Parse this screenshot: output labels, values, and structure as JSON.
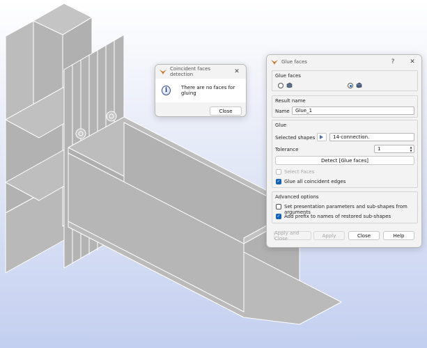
{
  "info_dialog": {
    "title": "Coincident faces detection",
    "message": "There are no faces for gluing",
    "close_label": "Close",
    "close_glyph": "✕"
  },
  "glue_dialog": {
    "title": "Glue faces",
    "help_glyph": "?",
    "close_glyph": "✕",
    "type_group": {
      "title": "Glue faces",
      "selected_option": 2
    },
    "result_group": {
      "title": "Result name",
      "name_label": "Name",
      "name_value": "Glue_1"
    },
    "glue_group": {
      "title": "Glue",
      "selected_shapes_label": "Selected shapes",
      "selected_shapes_value": "14-connection.",
      "tolerance_label": "Tolerance",
      "tolerance_value": "1",
      "detect_label": "Detect [Glue faces]",
      "select_faces_label": "Select Faces",
      "select_faces_checked": false,
      "glue_edges_label": "Glue all coincident edges",
      "glue_edges_checked": true
    },
    "advanced_group": {
      "title": "Advanced options",
      "set_presentation_label": "Set presentation parameters and sub-shapes from arguments",
      "set_presentation_checked": false,
      "add_prefix_label": "Add prefix to names of restored sub-shapes",
      "add_prefix_checked": true
    },
    "buttons": {
      "apply_close": "Apply and Close",
      "apply": "Apply",
      "close": "Close",
      "help": "Help"
    }
  },
  "colors": {
    "viewport_top": "#ffffff",
    "viewport_bottom": "#c3cff0",
    "model_fill": "#b7b7b7",
    "model_edge": "#ffffff",
    "accent": "#1561b8"
  }
}
